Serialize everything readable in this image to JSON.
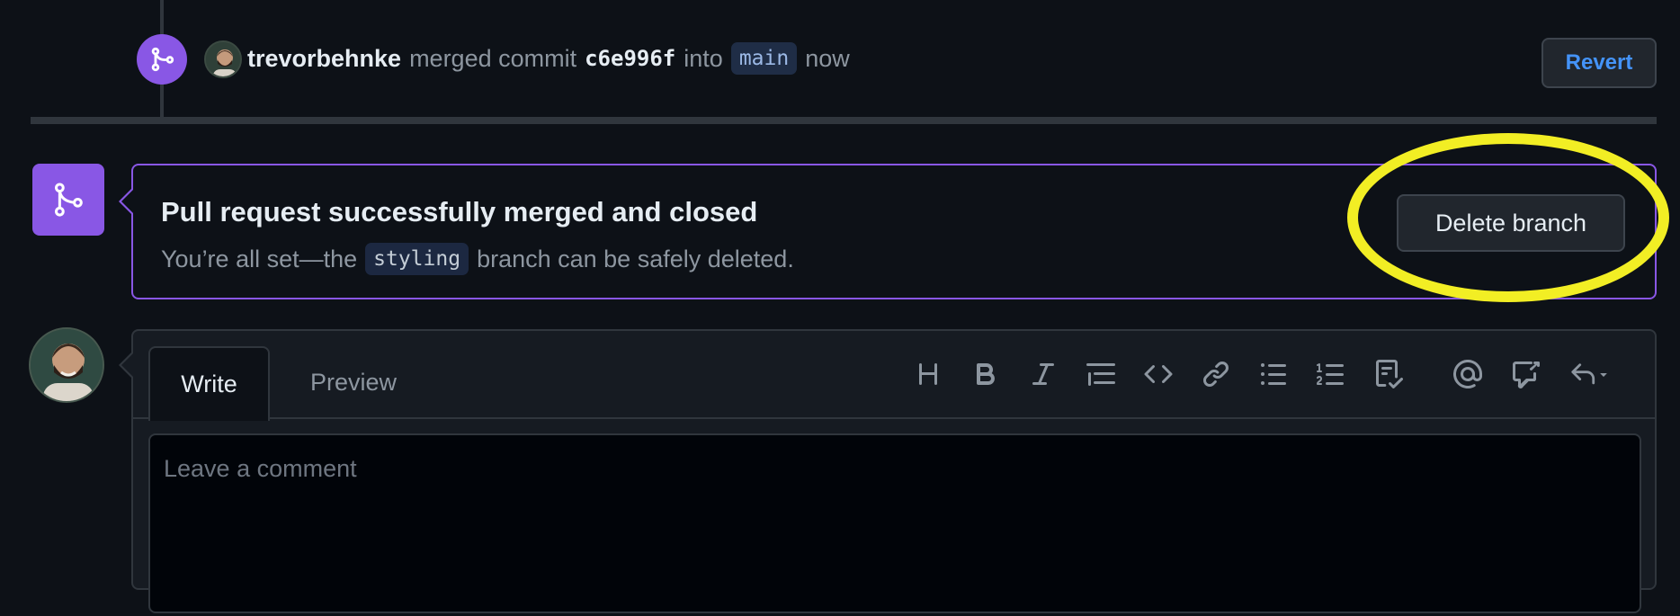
{
  "event": {
    "author": "trevorbehnke",
    "action_text": "merged commit",
    "commit_sha": "c6e996f",
    "into_text": "into",
    "target_branch": "main",
    "time": "now",
    "revert_label": "Revert"
  },
  "merged_notice": {
    "title": "Pull request successfully merged and closed",
    "subtitle_prefix": "You’re all set—the",
    "branch": "styling",
    "subtitle_suffix": "branch can be safely deleted.",
    "delete_label": "Delete branch",
    "highlight_color": "#f2ee24"
  },
  "composer": {
    "tabs": [
      {
        "label": "Write",
        "active": true
      },
      {
        "label": "Preview",
        "active": false
      }
    ],
    "toolbar_icons": [
      "heading-icon",
      "bold-icon",
      "italic-icon",
      "quote-icon",
      "code-icon",
      "link-icon",
      "unordered-list-icon",
      "ordered-list-icon",
      "task-list-icon",
      "mention-icon",
      "cross-reference-icon",
      "saved-reply-icon"
    ],
    "placeholder": "Leave a comment"
  },
  "colors": {
    "background": "#0d1117",
    "merged_purple": "#8957e5",
    "link_blue": "#4493f8"
  }
}
